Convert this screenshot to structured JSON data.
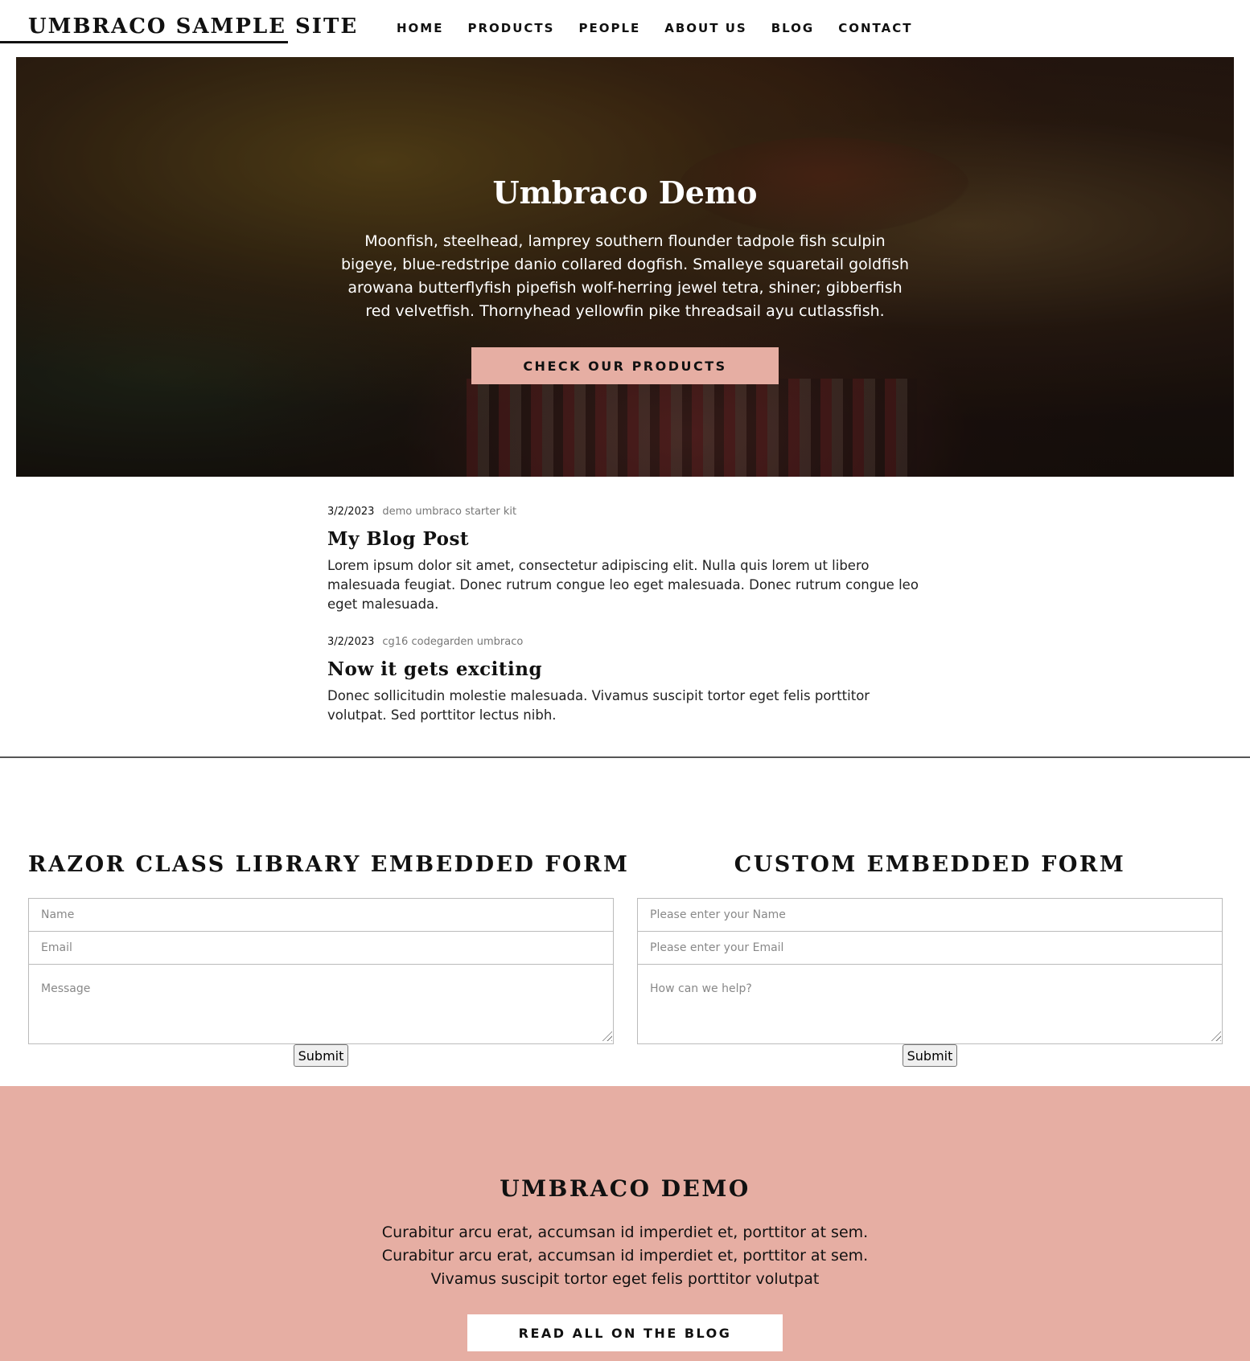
{
  "header": {
    "site_title": "UMBRACO SAMPLE SITE",
    "nav": [
      "HOME",
      "PRODUCTS",
      "PEOPLE",
      "ABOUT US",
      "BLOG",
      "CONTACT"
    ]
  },
  "hero": {
    "title": "Umbraco Demo",
    "text": "Moonfish, steelhead, lamprey southern flounder tadpole fish sculpin bigeye, blue-redstripe danio collared dogfish. Smalleye squaretail goldfish arowana butterflyfish pipefish wolf-herring jewel tetra, shiner; gibberfish red velvetfish. Thornyhead yellowfin pike threadsail ayu cutlassfish.",
    "button": "CHECK OUR PRODUCTS"
  },
  "posts": [
    {
      "date": "3/2/2023",
      "tags": "demo umbraco starter kit",
      "title": "My Blog Post",
      "excerpt": "Lorem ipsum dolor sit amet, consectetur adipiscing elit. Nulla quis lorem ut libero malesuada feugiat. Donec rutrum congue leo eget malesuada. Donec rutrum congue leo eget malesuada."
    },
    {
      "date": "3/2/2023",
      "tags": "cg16 codegarden umbraco",
      "title": "Now it gets exciting",
      "excerpt": "Donec sollicitudin molestie malesuada. Vivamus suscipit tortor eget felis porttitor volutpat. Sed porttitor lectus nibh."
    }
  ],
  "forms": {
    "left": {
      "title": "RAZOR CLASS LIBRARY EMBEDDED FORM",
      "name_placeholder": "Name",
      "email_placeholder": "Email",
      "message_placeholder": "Message",
      "submit": "Submit"
    },
    "right": {
      "title": "CUSTOM EMBEDDED FORM",
      "name_placeholder": "Please enter your Name",
      "email_placeholder": "Please enter your Email",
      "message_placeholder": "How can we help?",
      "submit": "Submit"
    }
  },
  "band": {
    "title": "UMBRACO DEMO",
    "text": "Curabitur arcu erat, accumsan id imperdiet et, porttitor at sem. Curabitur arcu erat, accumsan id imperdiet et, porttitor at sem. Vivamus suscipit tortor eget felis porttitor volutpat",
    "button": "READ ALL ON THE BLOG"
  },
  "colors": {
    "accent": "#e6aea3",
    "text": "#111111"
  }
}
